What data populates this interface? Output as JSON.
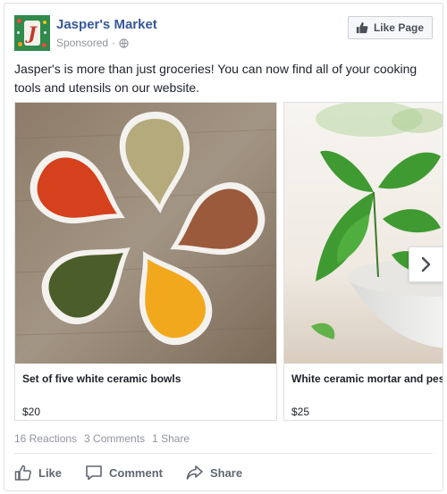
{
  "post": {
    "page_name": "Jasper's Market",
    "sponsored": "Sponsored",
    "privacy_icon": "globe-icon",
    "like_page_label": "Like Page",
    "message": "Jasper's is more than just groceries! You can now find all of your cooking tools and utensils on our website.",
    "brand_color": "#365899"
  },
  "carousel": {
    "cards": [
      {
        "title": "Set of five white ceramic bowls",
        "price": "$20"
      },
      {
        "title": "White ceramic mortar and pestle",
        "price": "$25"
      }
    ],
    "next_icon": "chevron-right-icon"
  },
  "stats": {
    "reactions": "16 Reactions",
    "comments": "3 Comments",
    "shares": "1 Share"
  },
  "actions": {
    "like": "Like",
    "comment": "Comment",
    "share": "Share"
  }
}
